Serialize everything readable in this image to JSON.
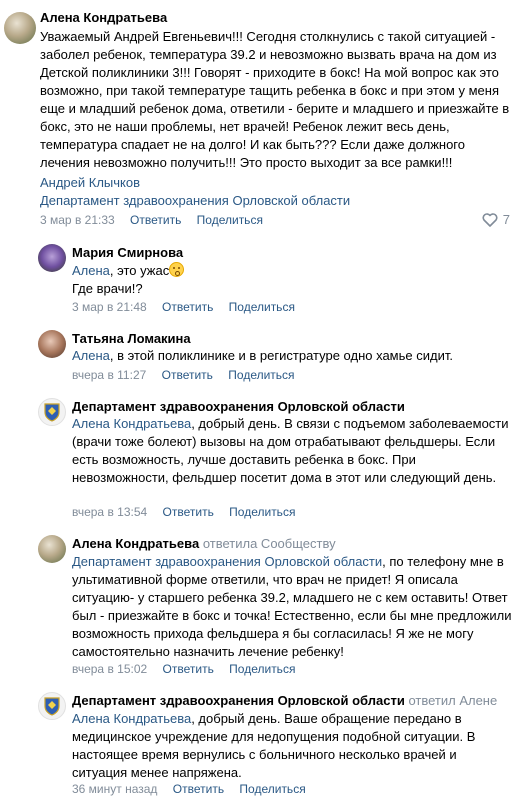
{
  "colors": {
    "link": "#2a5885",
    "muted": "#818c99",
    "text": "#000000"
  },
  "actions": {
    "reply": "Ответить",
    "share": "Поделиться"
  },
  "comments": [
    {
      "author": "Алена Кондратьева",
      "text": "Уважаемый Андрей Евгеньевич!!! Сегодня столкнулись с такой ситуацией - заболел ребенок, температура 39.2 и невозможно вызвать врача на дом из Детской поликлиники 3!!! Говорят - приходите в бокс! На мой вопрос как это возможно, при такой температуре тащить ребенка в бокс и при этом у меня еще и младший ребенок дома, ответили - берите и младшего и приезжайте в бокс, это не наши проблемы, нет врачей! Ребенок лежит весь день, температура спадает не на долго! И как быть??? Если даже должного лечения невозможно получить!!! Это просто выходит за все рамки!!!",
      "mention1": "Андрей Клычков",
      "mention2": "Департамент здравоохранения Орловской области",
      "time": "3 мар в 21:33",
      "likes": "7",
      "avatar_icon": "user-photo-icon"
    },
    {
      "author": "Мария Смирнова",
      "mention": "Алена",
      "text_part1": ", это ужас",
      "text_part2": "Где врачи!?",
      "time": "3 мар в 21:48",
      "avatar_icon": "user-photo-icon"
    },
    {
      "author": "Татьяна Ломакина",
      "mention": "Алена",
      "text": ", в этой поликлинике и в регистратуре одно хамье сидит.",
      "time": "вчера в 11:27",
      "avatar_icon": "user-photo-icon"
    },
    {
      "author": "Департамент здравоохранения Орловской области",
      "mention": "Алена Кондратьева",
      "text": ", добрый день. В связи с подъемом заболеваемости (врачи тоже болеют) вызовы на дом отрабатывают фельдшеры. Если есть возможность, лучше доставить ребенка в бокс. При невозможности, фельдшер посетит дома в этот или следующий день.",
      "time": "вчера в 13:54",
      "avatar_icon": "coat-of-arms-icon"
    },
    {
      "author": "Алена Кондратьева",
      "replied": "ответила Сообществу",
      "mention": "Департамент здравоохранения Орловской области",
      "text": ", по телефону мне в ультимативной форме ответили, что врач не придет! Я описала ситуацию- у старшего ребенка 39.2, младшего не с кем оставить! Ответ был - приезжайте в бокс и точка! Естественно, если бы мне предложили возможность прихода фельдшера я бы согласилась! Я же не могу самостоятельно назначить лечение ребенку!",
      "time": "вчера в 15:02",
      "avatar_icon": "user-photo-icon"
    },
    {
      "author": "Департамент здравоохранения Орловской области",
      "replied": "ответил Алене",
      "mention": "Алена Кондратьева",
      "text": ", добрый день. Ваше обращение передано в медицинское учреждение для недопущения подобной ситуации. В настоящее время вернулись с больничного несколько врачей и ситуация менее напряжена.",
      "time": "36 минут назад",
      "avatar_icon": "coat-of-arms-icon"
    }
  ]
}
